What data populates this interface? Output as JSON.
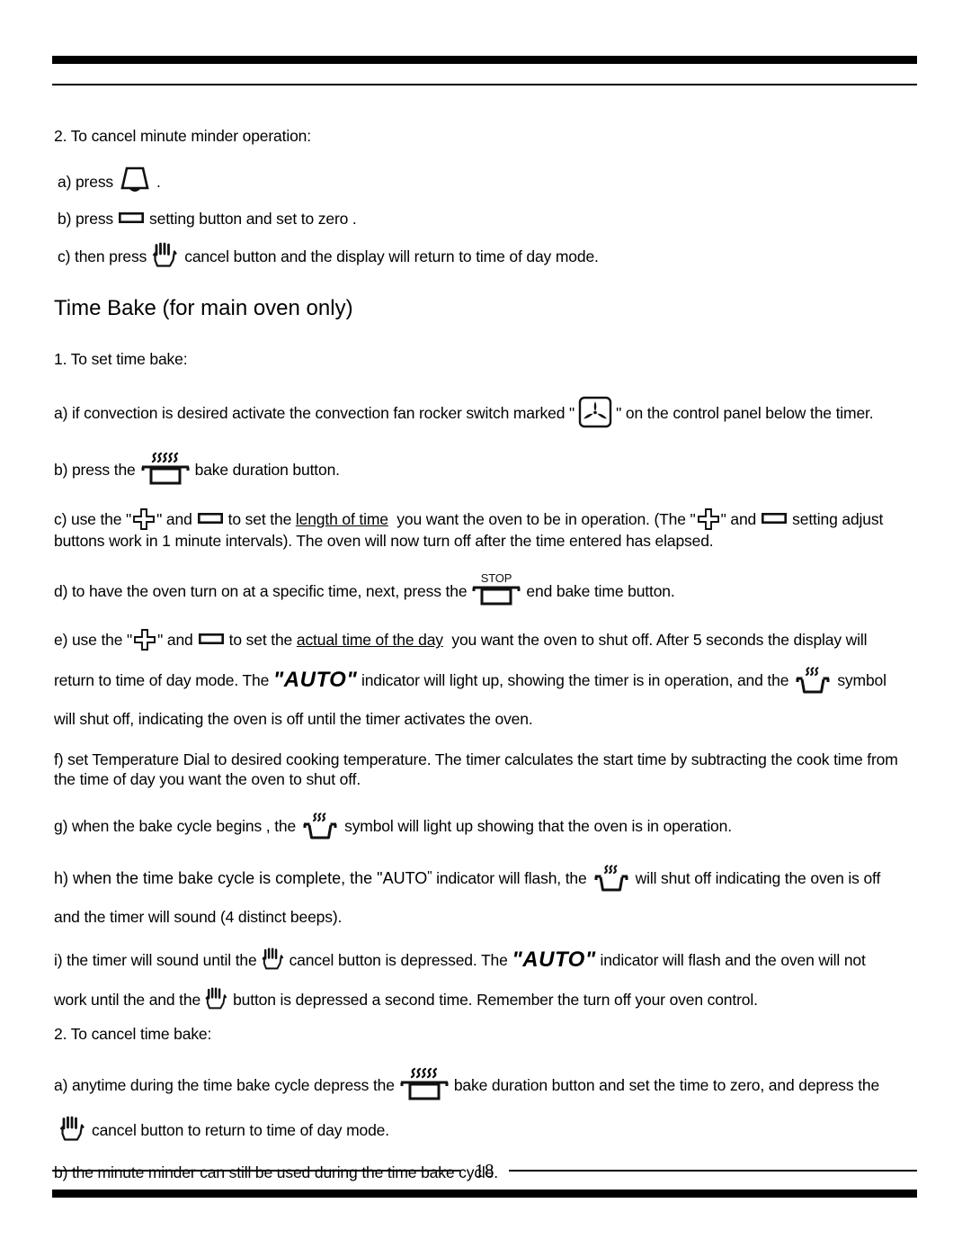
{
  "document": {
    "type": "appliance-manual-page",
    "page_number": "18"
  },
  "sections": {
    "cancel_minute_minder": {
      "heading": "2. To cancel minute minder operation:",
      "step_a_pre": "a) press",
      "step_a_post": ".",
      "step_b_pre": "b) press",
      "step_b_post": "setting button and set to zero .",
      "step_c_pre": "c) then press",
      "step_c_post": "cancel button and the display will return to time of day mode."
    },
    "time_bake": {
      "title": "Time Bake  (for main oven only)",
      "set_heading": "1. To set time bake:",
      "step_a_pre": "a) if convection is desired activate the convection fan rocker switch marked \"",
      "step_a_post": "\" on the control panel below the timer.",
      "step_b_pre": "b) press the",
      "step_b_post": "bake duration button.",
      "step_c_1": "c) use the \"",
      "step_c_2": "\" and",
      "step_c_3": "to set the",
      "step_c_underline": "length of time",
      "step_c_4": "you want the oven to be in operation. (The \"",
      "step_c_5": "\" and",
      "step_c_6": "setting adjust",
      "step_c_line2": "buttons work in 1 minute  intervals). The oven will now turn off after the time entered has elapsed.",
      "step_d_pre": "d) to have the oven turn on at a specific time,  next, press the",
      "step_d_post": "end bake time button.",
      "step_e_1": "e) use the \"",
      "step_e_2": "\" and",
      "step_e_3": "to set the",
      "step_e_underline": "actual time of the day",
      "step_e_4": "you want the oven to shut off. After 5 seconds the display will",
      "step_e_line2_a": "return to time of day mode. The",
      "step_e_auto": "\"AUTO\"",
      "step_e_line2_b": "indicator will light up,  showing the timer is in operation, and the",
      "step_e_line2_c": "symbol",
      "step_e_line3": "will shut off, indicating the oven is off until the timer activates the oven.",
      "step_f_line1": "f) set Temperature Dial to desired cooking temperature. The timer calculates the start time by subtracting the cook time from",
      "step_f_line2": "the time of day you want the oven to shut off.",
      "step_g_pre": "g) when the bake cycle begins  , the",
      "step_g_post": "symbol will light up showing that the oven is in operation.",
      "step_h_1": "h) when the time bake cycle  is complete, the  \"AUTO",
      "step_h_2": "\"",
      "step_h_3": "indicator will flash, the",
      "step_h_4": "will shut off indicating the oven is off",
      "step_h_line2": "and the timer will sound (4 distinct beeps).",
      "step_i_1": "i) the timer will sound until the",
      "step_i_2": "cancel button  is depressed. The",
      "step_i_auto": "\"AUTO\"",
      "step_i_3": "indicator will flash and the oven will not",
      "step_i_line2_a": "work until the and the",
      "step_i_line2_b": "button is depressed a second time. Remember the turn off your oven control."
    },
    "cancel_time_bake": {
      "heading": "2. To cancel time bake:",
      "step_a_pre": "a)  anytime during the time bake cycle depress the",
      "step_a_mid": "bake duration button and set the time to zero, and depress the",
      "step_a_line2": "cancel button   to return to time of day mode.",
      "step_b": "b)  the minute minder can still be used during the time bake cycle."
    }
  },
  "icons": {
    "minute_minder": "bell-icon",
    "minus_setting": "minus-setting-icon",
    "plus_setting": "plus-setting-icon",
    "cancel_hand": "hand-cancel-icon",
    "convection_fan": "convection-fan-icon",
    "bake_duration": "bake-duration-pan-icon",
    "end_bake_time": "stop-pan-icon",
    "oven_on": "oven-heat-pan-icon"
  },
  "colors": {
    "ink": "#000000",
    "paper": "#ffffff"
  }
}
